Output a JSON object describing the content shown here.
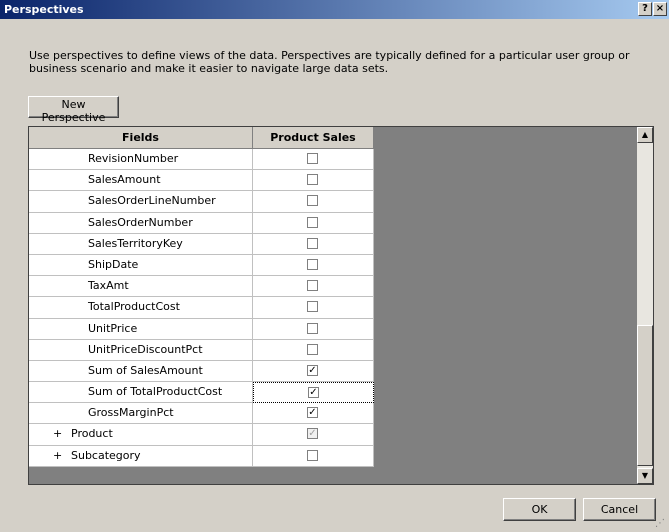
{
  "window": {
    "title": "Perspectives",
    "help_label": "?",
    "close_label": "×"
  },
  "description": "Use perspectives to define views of the data. Perspectives are typically defined for a particular user group or business scenario and make it easier to navigate large data sets.",
  "new_perspective_label": "New Perspective",
  "grid": {
    "headers": {
      "fields": "Fields",
      "perspective": "Product Sales"
    },
    "rows": [
      {
        "label": "RevisionNumber",
        "checked": false
      },
      {
        "label": "SalesAmount",
        "checked": false
      },
      {
        "label": "SalesOrderLineNumber",
        "checked": false
      },
      {
        "label": "SalesOrderNumber",
        "checked": false
      },
      {
        "label": "SalesTerritoryKey",
        "checked": false
      },
      {
        "label": "ShipDate",
        "checked": false
      },
      {
        "label": "TaxAmt",
        "checked": false
      },
      {
        "label": "TotalProductCost",
        "checked": false
      },
      {
        "label": "UnitPrice",
        "checked": false
      },
      {
        "label": "UnitPriceDiscountPct",
        "checked": false
      },
      {
        "label": "Sum of SalesAmount",
        "checked": true
      },
      {
        "label": "Sum of TotalProductCost",
        "checked": true,
        "focused": true
      },
      {
        "label": "GrossMarginPct",
        "checked": true
      },
      {
        "label": "Product",
        "checked": true,
        "expandable": true,
        "dim": true,
        "expander": "+"
      },
      {
        "label": "Subcategory",
        "checked": false,
        "expandable": true,
        "expander": "+"
      }
    ]
  },
  "buttons": {
    "ok": "OK",
    "cancel": "Cancel"
  },
  "scroll_icons": {
    "up": "▲",
    "down": "▼"
  },
  "check_mark": "✓",
  "grip_glyph": "⋰"
}
